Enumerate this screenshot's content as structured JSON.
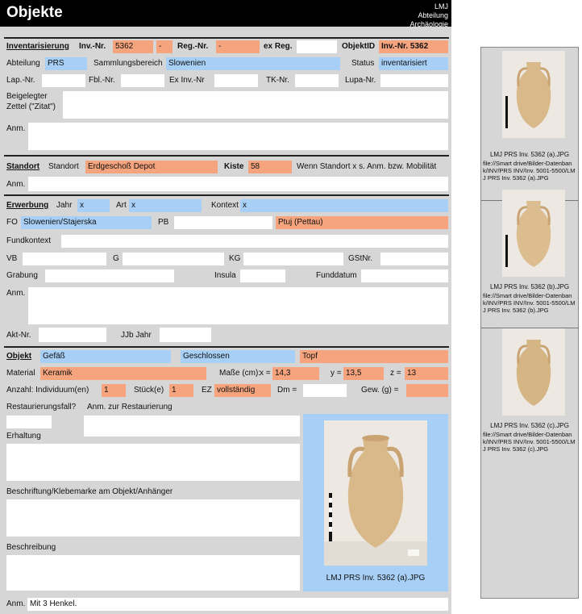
{
  "header": {
    "title": "Objekte",
    "right_lines": [
      "LMJ",
      "Abteilung",
      "Archäologie"
    ]
  },
  "inventory": {
    "section": "Inventarisierung",
    "inv_label": "Inv.-Nr.",
    "inv_value": "5362",
    "inv_suffix": "-",
    "reg_label": "Reg.-Nr.",
    "reg_value": "-",
    "exreg_label": "ex Reg.",
    "exreg_value": "",
    "objectid_label": "ObjektID",
    "objectid_value": "Inv.-Nr. 5362",
    "abteilung_label": "Abteilung",
    "abteilung_value": "PRS",
    "sammlung_label": "Sammlungsbereich",
    "sammlung_value": "Slowenien",
    "status_label": "Status",
    "status_value": "inventarisiert",
    "lap_label": "Lap.-Nr.",
    "fbl_label": "Fbl.-Nr.",
    "exinv_label": "Ex Inv.-Nr",
    "tk_label": "TK-Nr.",
    "lupa_label": "Lupa-Nr.",
    "beigelegter_label": "Beigelegter Zettel (\"Zitat\")",
    "anm_label": "Anm."
  },
  "location": {
    "section": "Standort",
    "standort_label": "Standort",
    "standort_value": "Erdgeschoß Depot",
    "kiste_label": "Kiste",
    "kiste_value": "58",
    "note": "Wenn Standort x s. Anm. bzw. Mobilität",
    "anm_label": "Anm."
  },
  "acquisition": {
    "section": "Erwerbung",
    "jahr_label": "Jahr",
    "jahr_value": "x",
    "art_label": "Art",
    "art_value": "x",
    "kontext_label": "Kontext",
    "kontext_value": "x",
    "fo_label": "FO",
    "fo_value": "Slowenien/Stajerska",
    "pb_label": "PB",
    "pb_value": "",
    "place_value": "Ptuj (Pettau)",
    "fundkontext_label": "Fundkontext",
    "vb_label": "VB",
    "g_label": "G",
    "kg_label": "KG",
    "gstnr_label": "GStNr.",
    "grabung_label": "Grabung",
    "insula_label": "Insula",
    "funddatum_label": "Funddatum",
    "anm_label": "Anm.",
    "akt_label": "Akt-Nr.",
    "jjb_label": "JJb Jahr"
  },
  "object": {
    "section": "Objekt",
    "type_value": "Gefäß",
    "closed_value": "Geschlossen",
    "form_value": "Topf",
    "material_label": "Material",
    "material_value": "Keramik",
    "masse_label": "Maße (cm):",
    "x_label": "x =",
    "x_value": "14,3",
    "y_label": "y =",
    "y_value": "13,5",
    "z_label": "z =",
    "z_value": "13",
    "anzahl_label": "Anzahl: Individuum(en)",
    "anzahl_value": "1",
    "stueck_label": "Stück(e)",
    "stueck_value": "1",
    "ez_label": "EZ",
    "ez_value": "vollständig",
    "dm_label": "Dm =",
    "dm_value": "",
    "gew_label": "Gew. (g) =",
    "gew_value": "",
    "restaurierung_label": "Restaurierungsfall?",
    "anm_restaurierung_label": "Anm. zur Restaurierung",
    "erhaltung_label": "Erhaltung",
    "beschriftung_label": "Beschriftung/Klebemarke am Objekt/Anhänger",
    "beschreibung_label": "Beschreibung",
    "photo_caption": "LMJ PRS Inv. 5362 (a).JPG",
    "anm_label": "Anm.",
    "anm_value": "Mit 3 Henkel."
  },
  "thumbnails": [
    {
      "caption": "LMJ PRS Inv. 5362 (a).JPG",
      "path": "file://Smart drive/Bilder-Datenbank/INV/PRS INV/Inv. 5001-5500/LMJ PRS Inv. 5362 (a).JPG"
    },
    {
      "caption": "LMJ PRS Inv. 5362 (b).JPG",
      "path": "file://Smart drive/Bilder-Datenbank/INV/PRS INV/Inv. 5001-5500/LMJ PRS Inv. 5362 (b).JPG"
    },
    {
      "caption": "LMJ PRS Inv. 5362 (c).JPG",
      "path": "file://Smart drive/Bilder-Datenbank/INV/PRS INV/Inv. 5001-5500/LMJ PRS Inv. 5362 (c).JPG"
    }
  ],
  "colors": {
    "blue_field": "#a8cff5",
    "orange_field": "#f6a47e",
    "panel_grey": "#d6d6d6"
  }
}
